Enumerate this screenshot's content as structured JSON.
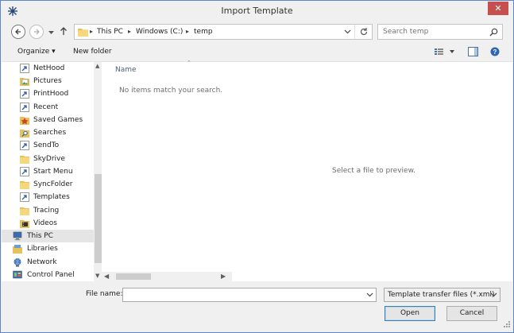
{
  "window": {
    "title": "Import Template",
    "close_label": "✕",
    "accent": "#5b87c7",
    "close_color": "#c7504f"
  },
  "nav": {
    "breadcrumb": [
      "This PC",
      "Windows (C:)",
      "temp"
    ],
    "search_placeholder": "Search temp"
  },
  "toolbar": {
    "organize_label": "Organize ▾",
    "new_folder_label": "New folder"
  },
  "sidebar": {
    "items": [
      {
        "label": "NetHood",
        "icon": "shortcut-icon"
      },
      {
        "label": "Pictures",
        "icon": "pictures-icon"
      },
      {
        "label": "PrintHood",
        "icon": "shortcut-icon"
      },
      {
        "label": "Recent",
        "icon": "shortcut-icon"
      },
      {
        "label": "Saved Games",
        "icon": "saved-games-icon"
      },
      {
        "label": "Searches",
        "icon": "searches-icon"
      },
      {
        "label": "SendTo",
        "icon": "shortcut-icon"
      },
      {
        "label": "SkyDrive",
        "icon": "folder-icon"
      },
      {
        "label": "Start Menu",
        "icon": "shortcut-icon"
      },
      {
        "label": "SyncFolder",
        "icon": "folder-icon"
      },
      {
        "label": "Templates",
        "icon": "shortcut-icon"
      },
      {
        "label": "Tracing",
        "icon": "folder-icon"
      },
      {
        "label": "Videos",
        "icon": "videos-icon"
      },
      {
        "label": "This PC",
        "icon": "computer-icon"
      },
      {
        "label": "Libraries",
        "icon": "libraries-icon"
      },
      {
        "label": "Network",
        "icon": "network-icon"
      },
      {
        "label": "Control Panel",
        "icon": "control-panel-icon"
      }
    ],
    "selected": "This PC"
  },
  "content": {
    "column_name": "Name",
    "empty_message": "No items match your search.",
    "preview_message": "Select a file to preview."
  },
  "footer": {
    "filename_label": "File name:",
    "filename_value": "",
    "filter_value": "Template transfer files (*.xml)",
    "open_label": "Open",
    "cancel_label": "Cancel"
  }
}
